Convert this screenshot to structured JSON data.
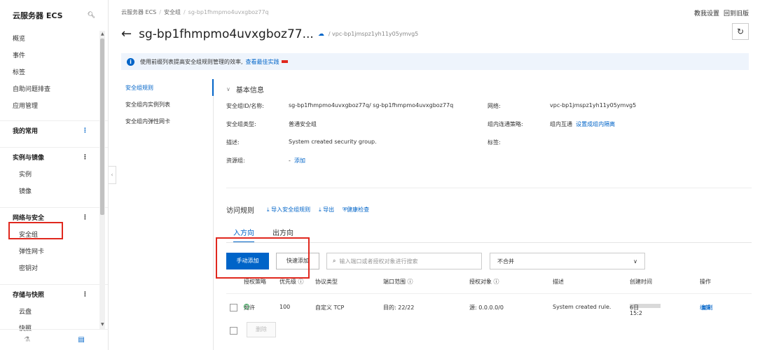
{
  "sidebar": {
    "title": "云服务器 ECS",
    "items": [
      "概览",
      "事件",
      "标签",
      "自助问题排查",
      "应用管理"
    ],
    "groups": [
      {
        "label": "我的常用",
        "children": []
      },
      {
        "label": "实例与镜像",
        "children": [
          "实例",
          "镜像"
        ]
      },
      {
        "label": "网络与安全",
        "children": [
          "安全组",
          "弹性网卡",
          "密钥对"
        ]
      },
      {
        "label": "存储与快照",
        "children": [
          "云盘",
          "快照"
        ]
      }
    ],
    "more_glyph": "⋮"
  },
  "breadcrumb": {
    "items": [
      "云服务器 ECS",
      "安全组",
      "sg-bp1fhmpmo4uvxgboz77q"
    ]
  },
  "top_links": [
    "教我设置",
    "回到旧版"
  ],
  "header": {
    "title": "sg-bp1fhmpmo4uvxgboz77...",
    "vpc": "/ vpc-bp1jmspz1yh11y05ymvg5"
  },
  "banner": {
    "text": "使用前缀列表提高安全组规则管理的效率,",
    "link": "查看最佳实践"
  },
  "subnav": [
    "安全组规则",
    "安全组内实例列表",
    "安全组内弹性网卡"
  ],
  "basic_info": {
    "title": "基本信息",
    "rows": [
      {
        "label": "安全组ID/名称:",
        "value": "sg-bp1fhmpmo4uvxgboz77q/ sg-bp1fhmpmo4uvxgboz77q",
        "label2": "网络:",
        "value2": "vpc-bp1jmspz1yh11y05ymvg5"
      },
      {
        "label": "安全组类型:",
        "value": "普通安全组",
        "label2": "组内连通策略:",
        "value2": "组内互通",
        "link2": "设置成组内隔离"
      },
      {
        "label": "描述:",
        "value": "System created security group.",
        "label2": "标签:",
        "value2": ""
      },
      {
        "label": "资源组:",
        "value": "-",
        "link": "添加"
      }
    ]
  },
  "rules": {
    "title": "访问规则",
    "actions": [
      "导入安全组规则",
      "导出",
      "健康检查"
    ],
    "tabs": [
      "入方向",
      "出方向"
    ],
    "add_button": "手动添加",
    "quick_add_button": "快速添加",
    "search_placeholder": "输入端口或者授权对象进行搜索",
    "filter_value": "不合并",
    "columns": [
      "授权策略",
      "优先级 ⓘ",
      "协议类型",
      "端口范围 ⓘ",
      "授权对象 ⓘ",
      "描述",
      "创建时间",
      "操作"
    ],
    "row": {
      "policy": "允许",
      "priority": "100",
      "protocol": "自定义 TCP",
      "port": "目的: 22/22",
      "source": "源: 0.0.0.0/0",
      "description": "System created rule.",
      "created": "6日",
      "created2": "15:2",
      "ops": [
        "编辑",
        "复制"
      ]
    },
    "delete_button": "删除"
  },
  "colors": {
    "accent": "#0064c8",
    "highlight": "#e0281e",
    "banner_bg": "#eef4fc"
  }
}
